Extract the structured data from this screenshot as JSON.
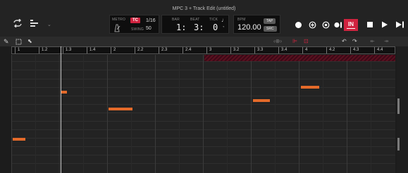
{
  "window": {
    "title": "MPC 3 + Track Edit (untitled)"
  },
  "header": {
    "metro": {
      "label": "METRO"
    },
    "tc": {
      "button_label": "TC",
      "value": "1/16"
    },
    "swing": {
      "label": "SWING",
      "value": "50"
    },
    "bar": {
      "label": "BAR",
      "value": "1:"
    },
    "beat": {
      "label": "BEAT",
      "value": "3:"
    },
    "tick": {
      "label": "TICK",
      "value": "0"
    },
    "bpm": {
      "label": "BPM",
      "value": "120.00",
      "tap_label": "TAP",
      "src_label": "SRC"
    },
    "in_label": "IN"
  },
  "ruler": {
    "marks": [
      "1",
      "1.2",
      "1.3",
      "1.4",
      "2",
      "2.2",
      "2.3",
      "2.4",
      "3",
      "3.2",
      "3.3",
      "3.4",
      "4",
      "4.2",
      "4.3",
      "4.4"
    ]
  },
  "colors": {
    "accent": "#d0233f",
    "note": "#e46a2a",
    "loop": "#5a1020",
    "background": "#232323"
  },
  "icons": {
    "loop": "loop-icon",
    "track": "track-list-icon",
    "pencil": "pencil-icon",
    "select": "select-box-icon",
    "pointer": "pointer-icon",
    "record": "record-icon",
    "overdub": "overdub-icon",
    "automation": "automation-icon",
    "stop": "stop-icon",
    "play": "play-icon",
    "play_start": "play-start-icon",
    "undo": "undo-icon",
    "redo": "redo-icon"
  }
}
